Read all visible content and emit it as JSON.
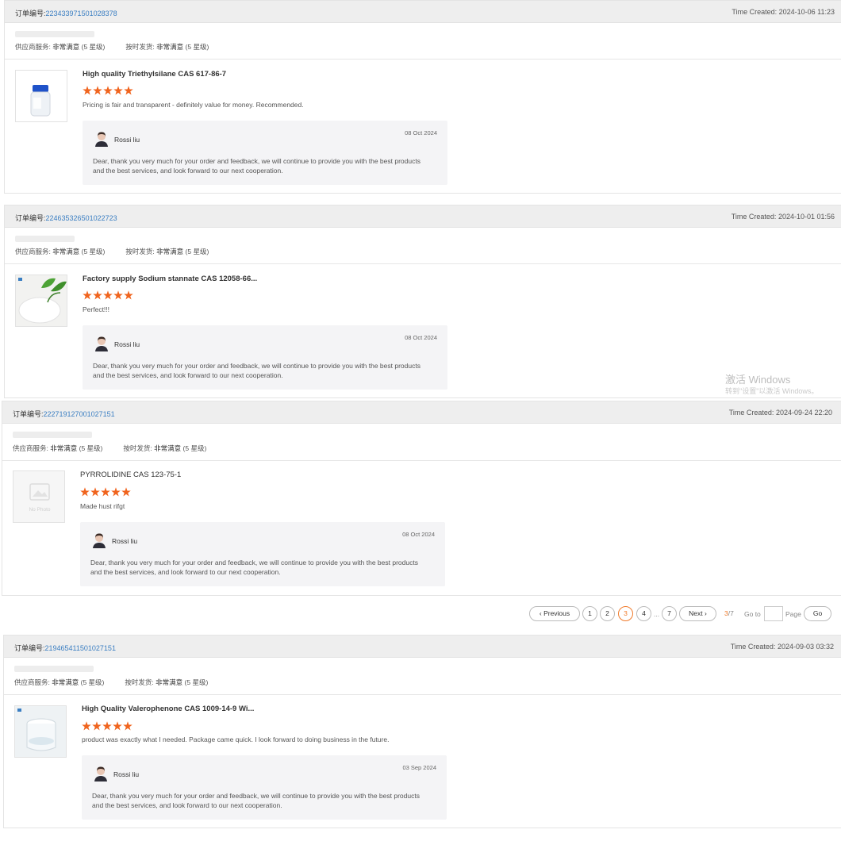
{
  "labels": {
    "order_prefix": "订单编号:",
    "created_prefix": "Time Created: ",
    "supplier_service": "供应商服务:",
    "on_time": "按时发货:",
    "rating_value": "非常满意",
    "rating_level": "(5 星级)"
  },
  "accent_color": "#f0641e",
  "link_color": "#3a7ec2",
  "orders": [
    {
      "order_number": "223433971501028378",
      "time_created": "2024-10-06 11:23",
      "product_name": "High quality Triethylsilane CAS 617-86-7",
      "stars": 5,
      "review": "Pricing is fair and transparent - definitely value for money. Recommended.",
      "reply_author": "Rossi liu",
      "reply_date": "08 Oct 2024",
      "reply_text": "Dear, thank you very much for your order and feedback, we will continue to provide you with the best products and the best services, and look forward to our next cooperation.",
      "thumb_icon": "bottle-icon"
    },
    {
      "order_number": "224635326501022723",
      "time_created": "2024-10-01 01:56",
      "product_name": "Factory supply Sodium stannate CAS 12058-66...",
      "stars": 5,
      "review": "Perfect!!!",
      "reply_author": "Rossi liu",
      "reply_date": "08 Oct 2024",
      "reply_text": "Dear, thank you very much for your order and feedback, we will continue to provide you with the best products and the best services, and look forward to our next cooperation.",
      "thumb_icon": "powder-plant-icon"
    },
    {
      "order_number": "222719127001027151",
      "time_created": "2024-09-24 22:20",
      "product_name": "PYRROLIDINE CAS 123-75-1",
      "stars": 5,
      "review": "Made hust rifgt",
      "reply_author": "Rossi liu",
      "reply_date": "08 Oct 2024",
      "reply_text": "Dear, thank you very much for your order and feedback, we will continue to provide you with the best products and the best services, and look forward to our next cooperation.",
      "thumb_icon": "no-photo-icon",
      "thumb_text": "No Photo"
    },
    {
      "order_number": "219465411501027151",
      "time_created": "2024-09-03 03:32",
      "product_name": "High Quality Valerophenone CAS 1009-14-9 Wi...",
      "stars": 5,
      "review": "product was exactly what I needed. Package came quick.  I look forward to doing business in the future.",
      "reply_author": "Rossi liu",
      "reply_date": "03 Sep 2024",
      "reply_text": "Dear, thank you very much for your order and feedback, we will continue to provide you with the best products and the best services, and look forward to our next cooperation.",
      "thumb_icon": "glass-jar-icon"
    }
  ],
  "pagination": {
    "previous": "Previous",
    "next": "Next",
    "pages": [
      "1",
      "2",
      "3",
      "4"
    ],
    "ellipsis": "...",
    "last_page": "7",
    "current": "3",
    "total": "/7",
    "goto_label": "Go to",
    "page_label": "Page",
    "go_button": "Go"
  },
  "watermark": {
    "line1": "激活 Windows",
    "line2": "转到\"设置\"以激活 Windows。"
  }
}
